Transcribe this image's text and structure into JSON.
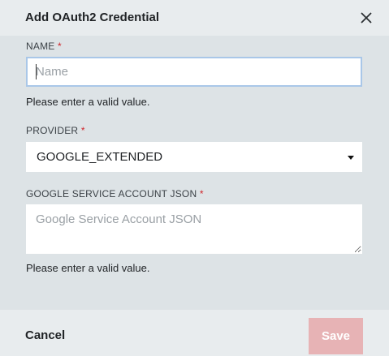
{
  "dialog": {
    "title": "Add OAuth2 Credential",
    "close_icon": "close-icon"
  },
  "fields": {
    "name": {
      "label": "NAME",
      "required_marker": "*",
      "placeholder": "Name",
      "value": "",
      "error": "Please enter a valid value."
    },
    "provider": {
      "label": "PROVIDER",
      "required_marker": "*",
      "selected": "GOOGLE_EXTENDED"
    },
    "service_account_json": {
      "label": "GOOGLE SERVICE ACCOUNT JSON",
      "required_marker": "*",
      "placeholder": "Google Service Account JSON",
      "value": "",
      "error": "Please enter a valid value."
    }
  },
  "footer": {
    "cancel_label": "Cancel",
    "save_label": "Save"
  },
  "colors": {
    "required": "#d0262b",
    "save_disabled": "#e7b3b5",
    "focus_border": "#a9c7e8"
  }
}
